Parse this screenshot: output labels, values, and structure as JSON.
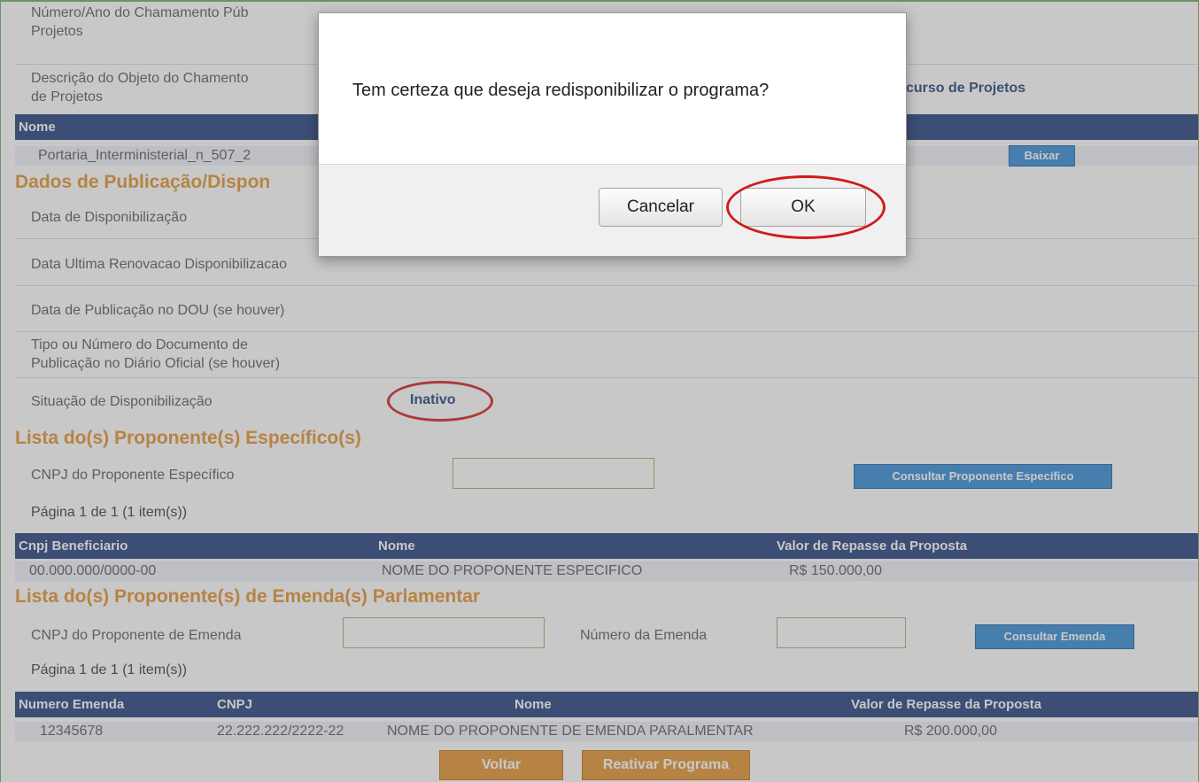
{
  "form": {
    "numero_label": "Número/Ano do Chamamento Público/Concurso de Projetos",
    "numero_label_line1": "Número/Ano do Chamamento Púb",
    "numero_label_line2": "Projetos",
    "descricao_label_line1": "Descrição do Objeto do Chamento",
    "descricao_label_line2": "de Projetos",
    "descricao_value_visible": "curso de Projetos"
  },
  "documents_table": {
    "header_nome": "Nome",
    "row_file": "Portaria_Interministerial_n_507_2",
    "download_button": "Baixar"
  },
  "publicacao": {
    "section_title": "Dados de Publicação/Dispon",
    "data_disponibilizacao_label": "Data de Disponibilização",
    "data_renovacao_label": "Data Ultima Renovacao Disponibilizacao",
    "data_publicacao_label": "Data de Publicação no DOU (se houver)",
    "tipo_documento_label_line1": "Tipo ou Número do Documento de",
    "tipo_documento_label_line2": "Publicação no Diário Oficial (se houver)",
    "situacao_label": "Situação de Disponibilização",
    "situacao_value": "Inativo"
  },
  "proponente_especifico": {
    "section_title": "Lista do(s) Proponente(s) Específico(s)",
    "cnpj_label": "CNPJ do Proponente Específico",
    "cnpj_value": "",
    "consult_button": "Consultar Proponente Específico",
    "pagination": "Página 1 de 1 (1 item(s))",
    "columns": [
      "Cnpj Beneficiario",
      "Nome",
      "Valor de Repasse da Proposta"
    ],
    "rows": [
      {
        "cnpj": "00.000.000/0000-00",
        "nome": "NOME DO PROPONENTE ESPECIFICO",
        "valor": "R$ 150.000,00"
      }
    ]
  },
  "proponente_emenda": {
    "section_title": "Lista do(s) Proponente(s) de Emenda(s) Parlamentar",
    "cnpj_label": "CNPJ do Proponente de Emenda",
    "cnpj_value": "",
    "numero_emenda_label": "Número da Emenda",
    "numero_emenda_value": "",
    "consult_button": "Consultar Emenda",
    "pagination": "Página 1 de 1 (1 item(s))",
    "columns": [
      "Numero Emenda",
      "CNPJ",
      "Nome",
      "Valor de Repasse da Proposta"
    ],
    "rows": [
      {
        "numero": "12345678",
        "cnpj": "22.222.222/2222-22",
        "nome": "NOME DO PROPONENTE DE EMENDA PARALMENTAR",
        "valor": "R$ 200.000,00"
      }
    ]
  },
  "actions": {
    "voltar": "Voltar",
    "reativar": "Reativar Programa"
  },
  "dialog": {
    "message": "Tem certeza que deseja redisponibilizar o programa?",
    "cancel_label": "Cancelar",
    "ok_label": "OK"
  },
  "colors": {
    "header_blue": "#1d3a7a",
    "section_orange": "#e3902b",
    "button_blue": "#2e88d6",
    "highlight_red": "#d11a1a"
  }
}
